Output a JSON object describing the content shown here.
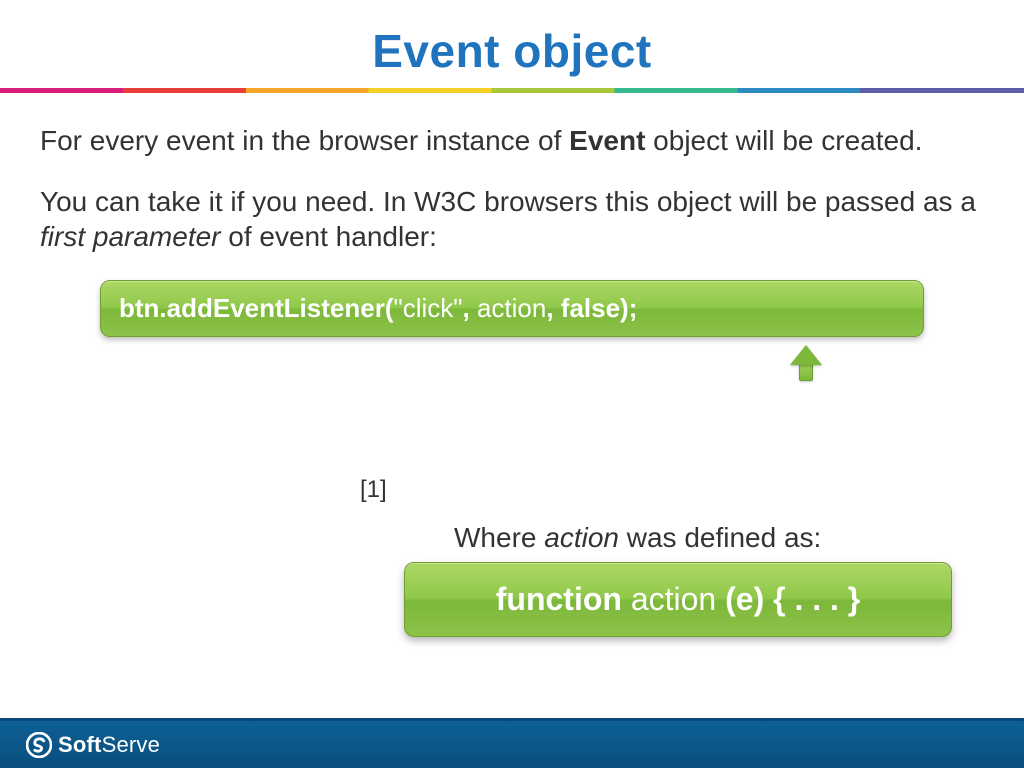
{
  "title": "Event object",
  "p1_pre": "For every event in the browser instance of ",
  "p1_bold": "Event",
  "p1_post": " object will be created.",
  "p2_pre": "You can take it if you need. In W3C browsers this object will be passed as a ",
  "p2_italic": "first parameter",
  "p2_post": " of event handler:",
  "code1_a": "btn.addEventListener(",
  "code1_b": "\"click\"",
  "code1_c": ", ",
  "code1_d": "action",
  "code1_e": ", ",
  "code1_f": "false);",
  "ref": "[1]",
  "where_pre": "Where ",
  "where_i": "action",
  "where_post": " was defined as:",
  "code2_a": "function",
  "code2_b": " action ",
  "code2_c": "(e) { . . . }",
  "brand_a": "Soft",
  "brand_b": "Serve"
}
